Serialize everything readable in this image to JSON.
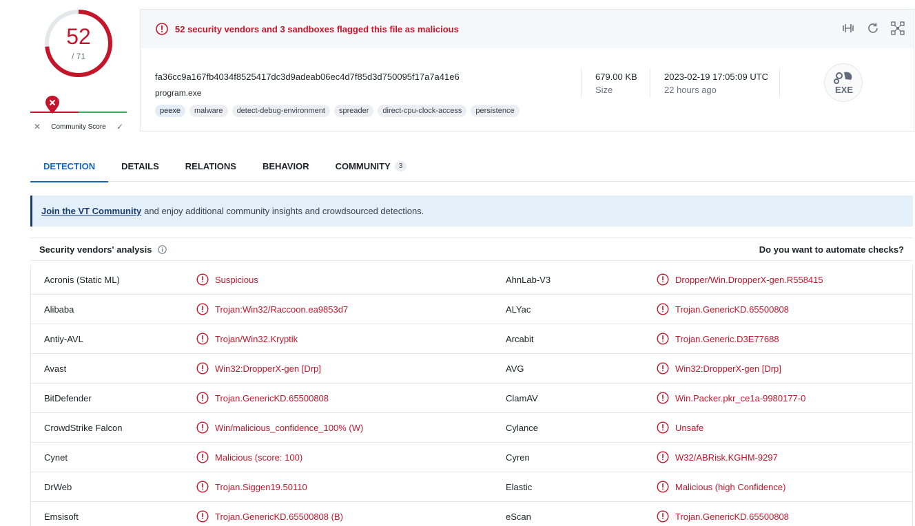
{
  "score": {
    "detected": "52",
    "total": "/ 71",
    "detected_fraction": 0.7324
  },
  "community_score": {
    "label": "Community Score"
  },
  "alert": {
    "text": "52 security vendors and 3 sandboxes flagged this file as malicious"
  },
  "file": {
    "hash": "fa36cc9a167fb4034f8525417dc3d9adeab06ec4d7f85d3d750095f17a7a41e6",
    "name": "program.exe",
    "tags": [
      "peexe",
      "malware",
      "detect-debug-environment",
      "spreader",
      "direct-cpu-clock-access",
      "persistence"
    ],
    "size": "679.00 KB",
    "size_label": "Size",
    "date": "2023-02-19 17:05:09 UTC",
    "date_relative": "22 hours ago",
    "type_label": "EXE"
  },
  "tabs": [
    {
      "label": "DETECTION",
      "active": true
    },
    {
      "label": "DETAILS"
    },
    {
      "label": "RELATIONS"
    },
    {
      "label": "BEHAVIOR"
    },
    {
      "label": "COMMUNITY",
      "badge": "3"
    }
  ],
  "banner": {
    "link": "Join the VT Community",
    "text": "and enjoy additional community insights and crowdsourced detections."
  },
  "vendors_header": {
    "title": "Security vendors' analysis",
    "automate": "Do you want to automate checks?"
  },
  "vendors": [
    {
      "left": {
        "name": "Acronis (Static ML)",
        "result": "Suspicious"
      },
      "right": {
        "name": "AhnLab-V3",
        "result": "Dropper/Win.DropperX-gen.R558415"
      }
    },
    {
      "left": {
        "name": "Alibaba",
        "result": "Trojan:Win32/Raccoon.ea9853d7"
      },
      "right": {
        "name": "ALYac",
        "result": "Trojan.GenericKD.65500808"
      }
    },
    {
      "left": {
        "name": "Antiy-AVL",
        "result": "Trojan/Win32.Kryptik"
      },
      "right": {
        "name": "Arcabit",
        "result": "Trojan.Generic.D3E77688"
      }
    },
    {
      "left": {
        "name": "Avast",
        "result": "Win32:DropperX-gen [Drp]"
      },
      "right": {
        "name": "AVG",
        "result": "Win32:DropperX-gen [Drp]"
      }
    },
    {
      "left": {
        "name": "BitDefender",
        "result": "Trojan.GenericKD.65500808"
      },
      "right": {
        "name": "ClamAV",
        "result": "Win.Packer.pkr_ce1a-9980177-0"
      }
    },
    {
      "left": {
        "name": "CrowdStrike Falcon",
        "result": "Win/malicious_confidence_100% (W)"
      },
      "right": {
        "name": "Cylance",
        "result": "Unsafe"
      }
    },
    {
      "left": {
        "name": "Cynet",
        "result": "Malicious (score: 100)"
      },
      "right": {
        "name": "Cyren",
        "result": "W32/ABRisk.KGHM-9297"
      }
    },
    {
      "left": {
        "name": "DrWeb",
        "result": "Trojan.Siggen19.50110"
      },
      "right": {
        "name": "Elastic",
        "result": "Malicious (high Confidence)"
      }
    },
    {
      "left": {
        "name": "Emsisoft",
        "result": "Trojan.GenericKD.65500808 (B)"
      },
      "right": {
        "name": "eScan",
        "result": "Trojan.GenericKD.65500808"
      }
    }
  ],
  "colors": {
    "malicious": "#c4162a",
    "accent": "#1565c0",
    "ok": "#34a853"
  }
}
